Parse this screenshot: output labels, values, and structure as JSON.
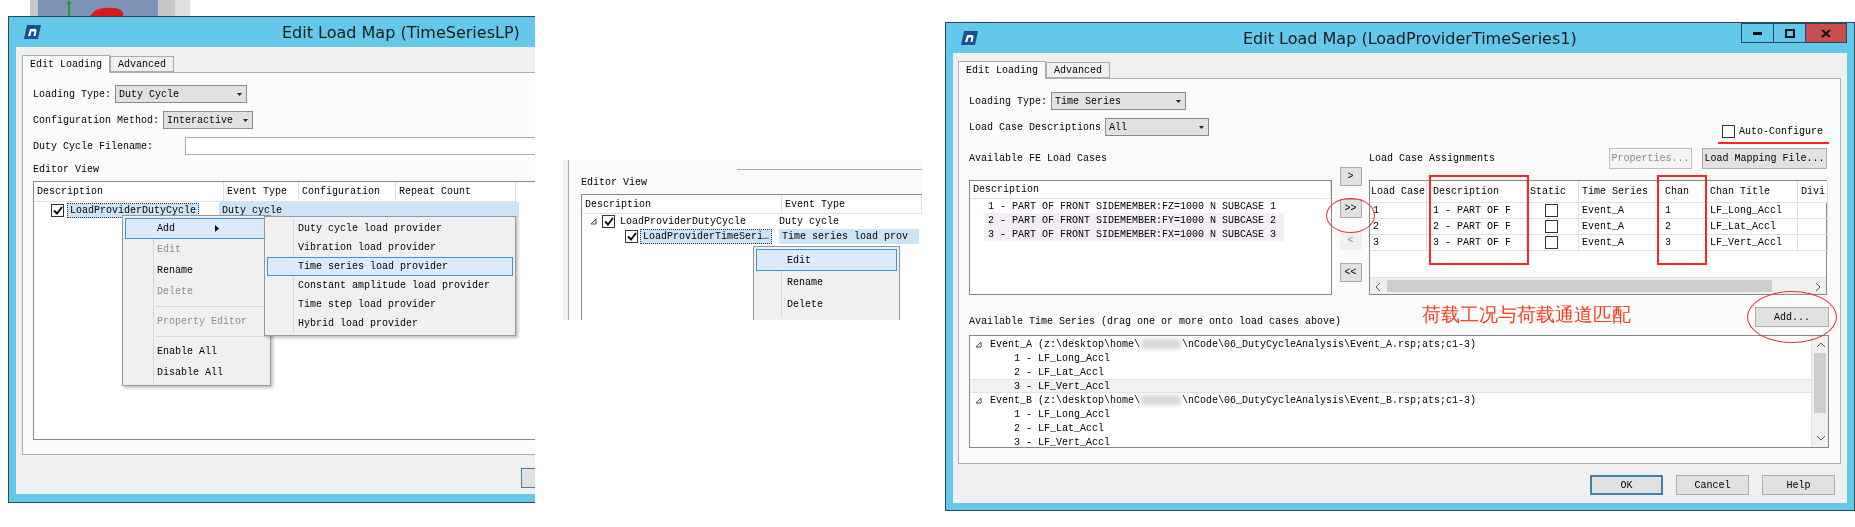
{
  "left_dialog": {
    "title": "Edit Load Map (TimeSeriesLP)",
    "tabs": [
      {
        "label": "Edit Loading",
        "selected": true
      },
      {
        "label": "Advanced",
        "selected": false
      }
    ],
    "fields": [
      {
        "label": "Loading Type:",
        "kind": "dropdown",
        "value": "Duty Cycle"
      },
      {
        "label": "Configuration Method:",
        "kind": "dropdown",
        "value": "Interactive"
      },
      {
        "label": "Duty Cycle Filename:",
        "kind": "text"
      }
    ],
    "editor_view": {
      "label": "Editor View",
      "columns": [
        "Description",
        "Event Type",
        "Configuration",
        "Repeat Count"
      ],
      "rows": [
        {
          "description": "LoadProviderDutyCycle",
          "event_type": "Duty cycle",
          "checked": true,
          "selected": true
        }
      ]
    },
    "context_menu": {
      "items": [
        {
          "kind": "item",
          "label": "Add",
          "disabled": false,
          "selected": true,
          "submenu": true
        },
        {
          "kind": "item",
          "label": "Edit",
          "disabled": true,
          "selected": false,
          "submenu": false
        },
        {
          "kind": "item",
          "label": "Rename",
          "disabled": false,
          "selected": false,
          "submenu": false
        },
        {
          "kind": "item",
          "label": "Delete",
          "disabled": true,
          "selected": false,
          "submenu": false
        },
        {
          "kind": "separator"
        },
        {
          "kind": "item",
          "label": "Property Editor",
          "disabled": true,
          "selected": false,
          "submenu": false
        },
        {
          "kind": "separator"
        },
        {
          "kind": "item",
          "label": "Enable All",
          "disabled": false,
          "selected": false,
          "submenu": false
        },
        {
          "kind": "item",
          "label": "Disable All",
          "disabled": false,
          "selected": false,
          "submenu": false
        }
      ]
    },
    "submenu": {
      "items": [
        {
          "label": "Duty cycle load provider",
          "selected": false
        },
        {
          "label": "Vibration load provider",
          "selected": false
        },
        {
          "label": "Time series load provider",
          "selected": true
        },
        {
          "label": "Constant amplitude load provider",
          "selected": false
        },
        {
          "label": "Time step load provider",
          "selected": false
        },
        {
          "label": "Hybrid load provider",
          "selected": false
        }
      ]
    }
  },
  "editor_fragment": {
    "label": "Editor View",
    "columns": [
      "Description",
      "Event Type"
    ],
    "rows": [
      {
        "description": "LoadProviderDutyCycle",
        "event_type": "Duty cycle",
        "checked": true,
        "selected": false,
        "expanded": true,
        "children": [
          {
            "description": "LoadProviderTimeSeri…",
            "event_type": "Time series load prov",
            "checked": true,
            "selected": true
          }
        ]
      }
    ],
    "context_menu": {
      "items": [
        {
          "label": "Edit",
          "selected": true
        },
        {
          "label": "Rename",
          "selected": false
        },
        {
          "label": "Delete",
          "selected": false
        }
      ]
    }
  },
  "right_dialog": {
    "title": "Edit Load Map (LoadProviderTimeSeries1)",
    "tabs": [
      {
        "label": "Edit Loading",
        "selected": true
      },
      {
        "label": "Advanced",
        "selected": false
      }
    ],
    "loading_type": {
      "label": "Loading Type:",
      "value": "Time Series"
    },
    "load_case_descriptions": {
      "label": "Load Case Descriptions",
      "value": "All"
    },
    "auto_configure": {
      "label": "Auto-Configure",
      "checked": false
    },
    "available_fe_load_cases": {
      "label": "Available FE Load Cases",
      "column": "Description",
      "rows": [
        {
          "text": "1 - PART OF FRONT SIDEMEMBER:FZ=1000 N SUBCASE 1",
          "selected": false
        },
        {
          "text": "2 - PART OF FRONT SIDEMEMBER:FY=1000 N SUBCASE 2",
          "selected": true
        },
        {
          "text": "3 - PART OF FRONT SIDEMEMBER:FX=1000 N SUBCASE 3",
          "selected": true
        }
      ]
    },
    "transfer_buttons": [
      {
        "label": ">",
        "disabled": false
      },
      {
        "label": ">>",
        "disabled": false
      },
      {
        "label": "<",
        "disabled": true
      },
      {
        "label": "<<",
        "disabled": false
      }
    ],
    "load_case_assignments": {
      "label": "Load Case Assignments",
      "buttons": [
        {
          "label": "Properties...",
          "disabled": true
        },
        {
          "label": "Load Mapping File...",
          "disabled": false
        }
      ],
      "columns": [
        "Load Case",
        "Description",
        "Static",
        "Time Series",
        "Chan",
        "Chan Title",
        "Divi"
      ],
      "rows": [
        {
          "load_case": "1",
          "description": "1 - PART OF F",
          "static": false,
          "time_series": "Event_A",
          "chan": "1",
          "chan_title": "LF_Long_Accl"
        },
        {
          "load_case": "2",
          "description": "2 - PART OF F",
          "static": false,
          "time_series": "Event_A",
          "chan": "2",
          "chan_title": "LF_Lat_Accl"
        },
        {
          "load_case": "3",
          "description": "3 - PART OF F",
          "static": false,
          "time_series": "Event_A",
          "chan": "3",
          "chan_title": "LF_Vert_Accl"
        }
      ]
    },
    "available_time_series": {
      "label": "Available Time Series (drag one or more onto load cases above)",
      "items": [
        {
          "path_start": "Event_A (z:\\desktop\\home\\",
          "path_end": "\\nCode\\06_DutyCycleAnalysis\\Event_A.rsp;ats;c1-3)",
          "expanded": true,
          "children": [
            {
              "label": "1 - LF_Long_Accl",
              "selected": false
            },
            {
              "label": "2 - LF_Lat_Accl",
              "selected": false
            },
            {
              "label": "3 - LF_Vert_Accl",
              "selected": true
            }
          ]
        },
        {
          "path_start": "Event_B (z:\\desktop\\home\\",
          "path_end": "\\nCode\\06_DutyCycleAnalysis\\Event_B.rsp;ats;c1-3)",
          "expanded": true,
          "children": [
            {
              "label": "1 - LF_Long_Accl",
              "selected": false
            },
            {
              "label": "2 - LF_Lat_Accl",
              "selected": false
            },
            {
              "label": "3 - LF_Vert_Accl",
              "selected": false
            }
          ]
        }
      ]
    },
    "annotation": "荷载工况与荷载通道匹配",
    "add_button": "Add...",
    "buttons": [
      {
        "label": "OK",
        "default": true
      },
      {
        "label": "Cancel",
        "default": false
      },
      {
        "label": "Help",
        "default": false
      }
    ]
  }
}
